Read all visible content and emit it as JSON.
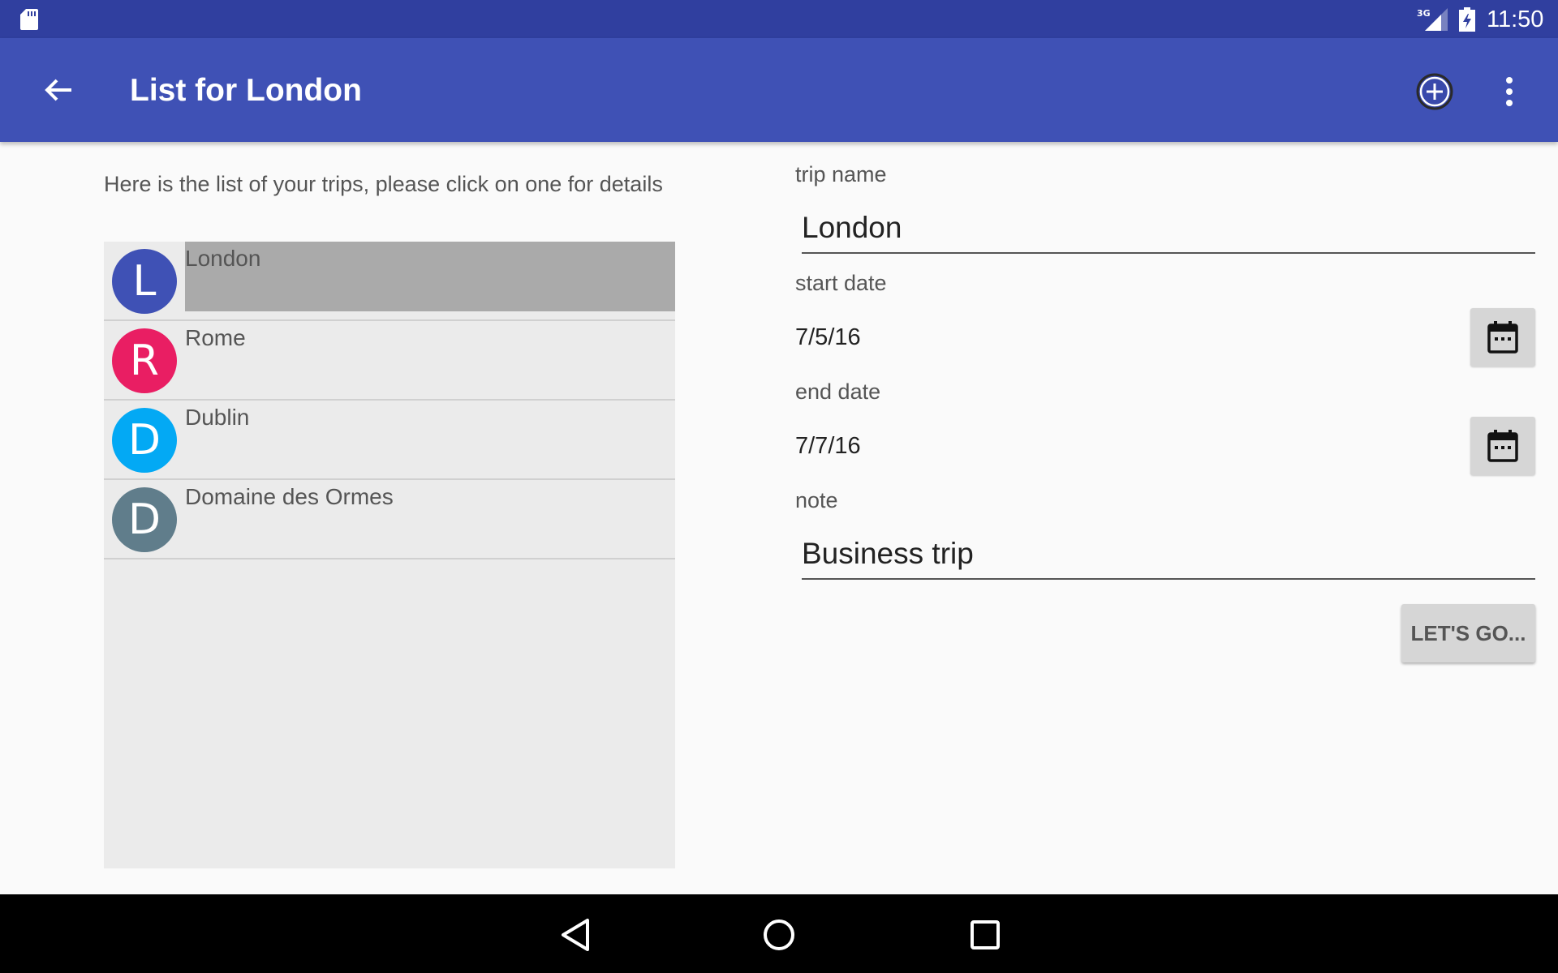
{
  "status_bar": {
    "time": "11:50",
    "network": "3G",
    "icons": [
      "sd-card-icon",
      "signal-3g-icon",
      "battery-charging-icon"
    ]
  },
  "app_bar": {
    "title": "List for London",
    "icons": [
      "back-arrow-icon",
      "add-circle-icon",
      "more-vert-icon"
    ]
  },
  "list_panel": {
    "intro": "Here is the list of your trips, please click on one for details",
    "trips": [
      {
        "name": "London",
        "initial": "L",
        "color": "#3f51b5",
        "selected": true
      },
      {
        "name": "Rome",
        "initial": "R",
        "color": "#e91e63",
        "selected": false
      },
      {
        "name": "Dublin",
        "initial": "D",
        "color": "#03a9f4",
        "selected": false
      },
      {
        "name": "Domaine des Ormes",
        "initial": "D",
        "color": "#607d8b",
        "selected": false
      }
    ]
  },
  "detail": {
    "trip_name_label": "trip name",
    "trip_name_value": "London",
    "start_date_label": "start date",
    "start_date_value": "7/5/16",
    "end_date_label": "end date",
    "end_date_value": "7/7/16",
    "note_label": "note",
    "note_value": "Business trip",
    "go_button": "LET'S GO..."
  },
  "colors": {
    "status_bar": "#303f9f",
    "app_bar": "#3f51b5",
    "selected_row": "#aaaaaa",
    "list_background": "#ebebeb"
  }
}
